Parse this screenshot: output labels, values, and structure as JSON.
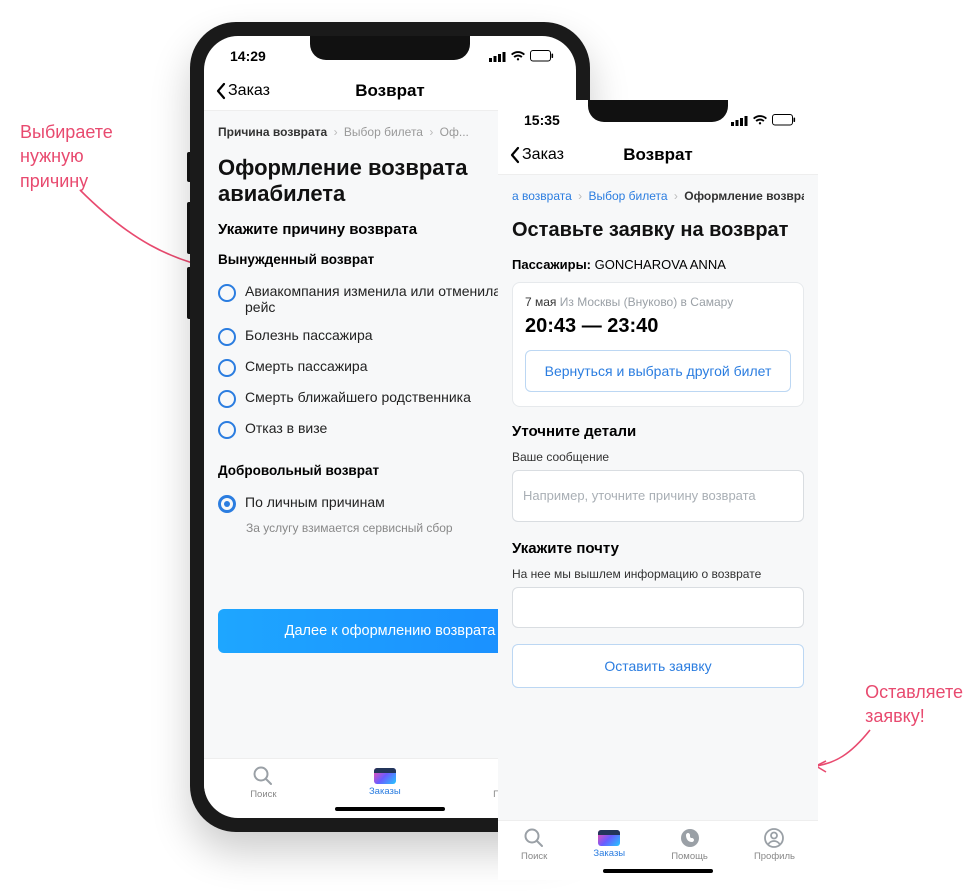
{
  "annotations": {
    "left": "Выбираете\nнужную\nпричину",
    "right": "Оставляете\nзаявку!"
  },
  "phone1": {
    "status_time": "14:29",
    "nav_back": "Заказ",
    "nav_title": "Возврат",
    "breadcrumb": {
      "step1": "Причина возврата",
      "step2": "Выбор билета",
      "step3": "Оф..."
    },
    "page_title": "Оформление возврата авиабилета",
    "sub_title": "Укажите причину возврата",
    "group_forced": "Вынужденный возврат",
    "forced_reasons": [
      "Авиакомпания изменила или отменила рейс",
      "Болезнь пассажира",
      "Смерть пассажира",
      "Смерть ближайшего родственника",
      "Отказ в визе"
    ],
    "group_voluntary": "Добровольный возврат",
    "voluntary_reason": "По личным причинам",
    "voluntary_hint": "За услугу взимается сервисный сбор",
    "primary_btn": "Далее к оформлению возврата",
    "tabs": {
      "search": "Поиск",
      "orders": "Заказы",
      "help": "Помощь"
    }
  },
  "phone2": {
    "status_time": "15:35",
    "nav_back": "Заказ",
    "nav_title": "Возврат",
    "breadcrumb": {
      "step1": "а возврата",
      "step2": "Выбор билета",
      "step3": "Оформление возврата"
    },
    "page_title": "Оставьте заявку на возврат",
    "passengers_label": "Пассажиры:",
    "passengers_value": "GONCHAROVA ANNA",
    "card": {
      "date": "7 мая",
      "route": "Из Москвы (Внуково) в Самару",
      "time": "20:43 — 23:40",
      "change_btn": "Вернуться и выбрать другой билет"
    },
    "details_title": "Уточните детали",
    "details_label": "Ваше сообщение",
    "details_placeholder": "Например, уточните причину возврата",
    "email_title": "Укажите почту",
    "email_label": "На нее мы вышлем информацию о возврате",
    "submit_btn": "Оставить заявку",
    "tabs": {
      "search": "Поиск",
      "orders": "Заказы",
      "help": "Помощь",
      "profile": "Профиль"
    }
  },
  "icons": {
    "signal": "signal",
    "wifi": "wifi",
    "battery": "battery"
  }
}
